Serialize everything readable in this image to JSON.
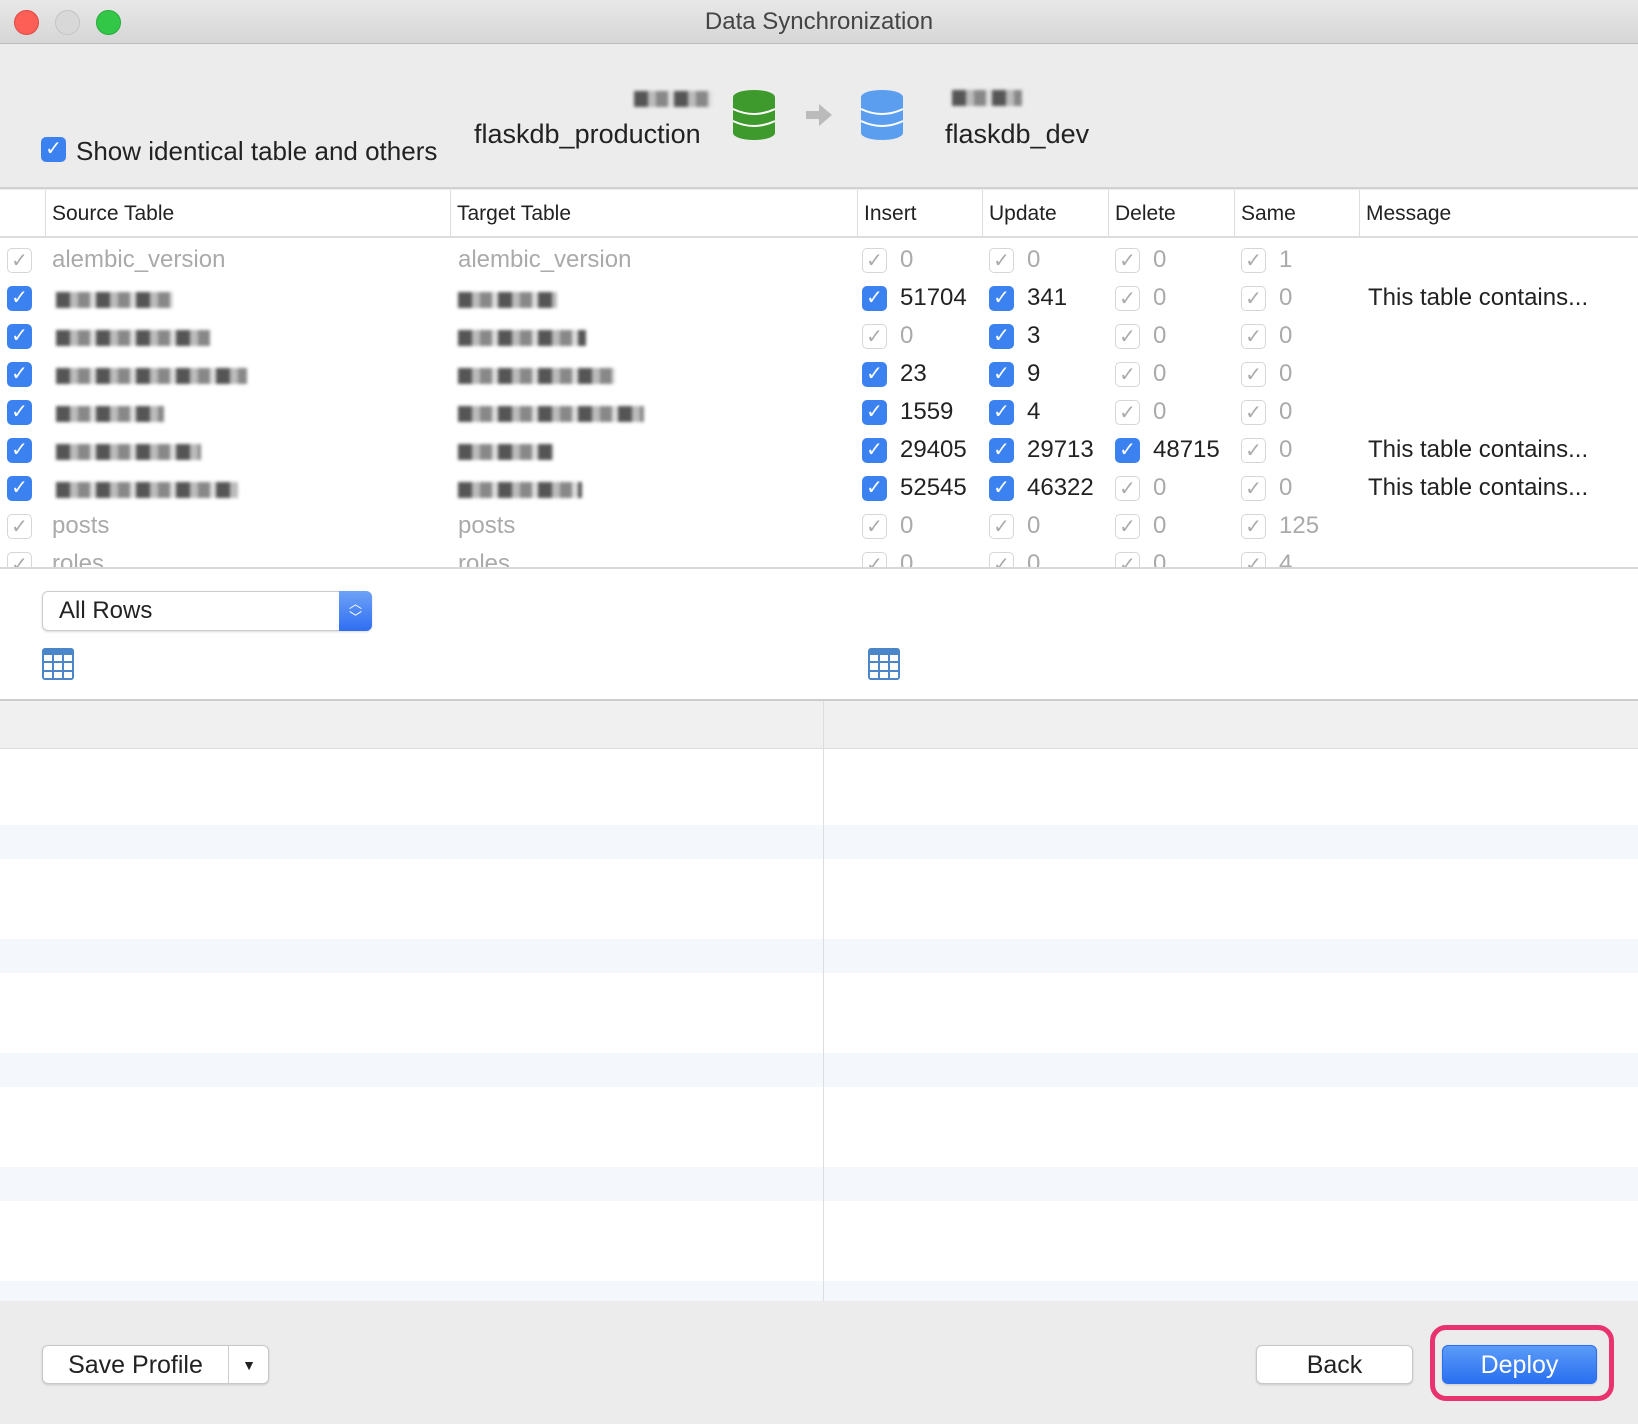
{
  "window": {
    "title": "Data Synchronization"
  },
  "top": {
    "show_identical_label": "Show identical table and others",
    "show_identical_checked": true,
    "source_db": "flaskdb_production",
    "target_db": "flaskdb_dev",
    "source_db_color": "#3f9a2e",
    "target_db_color": "#5b9ef0",
    "arrow_icon": "arrow-right-icon"
  },
  "table": {
    "headers": {
      "source": "Source Table",
      "target": "Target Table",
      "insert": "Insert",
      "update": "Update",
      "delete": "Delete",
      "same": "Same",
      "message": "Message"
    },
    "rows": [
      {
        "source": "alembic_version",
        "target": "alembic_version",
        "checked": false,
        "insert": "0",
        "insert_on": false,
        "update": "0",
        "update_on": false,
        "delete": "0",
        "delete_on": false,
        "same": "1",
        "message": ""
      },
      {
        "source": "",
        "target": "",
        "checked": true,
        "insert": "51704",
        "insert_on": true,
        "update": "341",
        "update_on": true,
        "delete": "0",
        "delete_on": false,
        "same": "0",
        "message": "This table contains..."
      },
      {
        "source": "",
        "target": "",
        "checked": true,
        "insert": "0",
        "insert_on": false,
        "update": "3",
        "update_on": true,
        "delete": "0",
        "delete_on": false,
        "same": "0",
        "message": ""
      },
      {
        "source": "",
        "target": "",
        "checked": true,
        "insert": "23",
        "insert_on": true,
        "update": "9",
        "update_on": true,
        "delete": "0",
        "delete_on": false,
        "same": "0",
        "message": ""
      },
      {
        "source": "",
        "target": "",
        "checked": true,
        "insert": "1559",
        "insert_on": true,
        "update": "4",
        "update_on": true,
        "delete": "0",
        "delete_on": false,
        "same": "0",
        "message": ""
      },
      {
        "source": "",
        "target": "",
        "checked": true,
        "insert": "29405",
        "insert_on": true,
        "update": "29713",
        "update_on": true,
        "delete": "48715",
        "delete_on": true,
        "same": "0",
        "message": "This table contains..."
      },
      {
        "source": "",
        "target": "",
        "checked": true,
        "insert": "52545",
        "insert_on": true,
        "update": "46322",
        "update_on": true,
        "delete": "0",
        "delete_on": false,
        "same": "0",
        "message": "This table contains..."
      },
      {
        "source": "posts",
        "target": "posts",
        "checked": false,
        "insert": "0",
        "insert_on": false,
        "update": "0",
        "update_on": false,
        "delete": "0",
        "delete_on": false,
        "same": "125",
        "message": ""
      },
      {
        "source": "roles",
        "target": "roles",
        "checked": false,
        "insert": "0",
        "insert_on": false,
        "update": "0",
        "update_on": false,
        "delete": "0",
        "delete_on": false,
        "same": "4",
        "message": ""
      }
    ]
  },
  "filter": {
    "selected": "All Rows"
  },
  "footer": {
    "save_profile": "Save Profile",
    "back": "Back",
    "deploy": "Deploy",
    "highlight_color": "#e8336e"
  }
}
